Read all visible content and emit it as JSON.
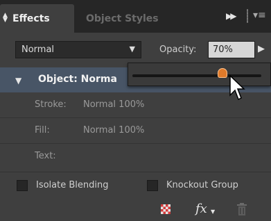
{
  "tabs": {
    "active": "Effects",
    "inactive": "Object Styles"
  },
  "blend": {
    "value": "Normal"
  },
  "opacity": {
    "label": "Opacity:",
    "value": "70%",
    "slider_fraction": 0.7
  },
  "object_row": {
    "label": "Object: Norma"
  },
  "attributes": [
    {
      "key": "Stroke:",
      "value": "Normal 100%"
    },
    {
      "key": "Fill:",
      "value": "Normal 100%"
    },
    {
      "key": "Text:",
      "value": ""
    }
  ],
  "checkboxes": {
    "isolate": "Isolate Blending",
    "knockout": "Knockout Group"
  },
  "icons": {
    "panel_arrows": "expand-collapse-arrows-icon",
    "collapse": "double-chevron-right-icon",
    "menu": "panel-menu-icon",
    "opacity_arrow": "triangle-right-icon",
    "clear": "clear-effects-icon",
    "fx": "fx-icon",
    "trash": "trash-icon"
  },
  "colors": {
    "panel_bg": "#3f3f3f",
    "selected_row": "#485566",
    "slider_knob": "#e07a2a"
  }
}
